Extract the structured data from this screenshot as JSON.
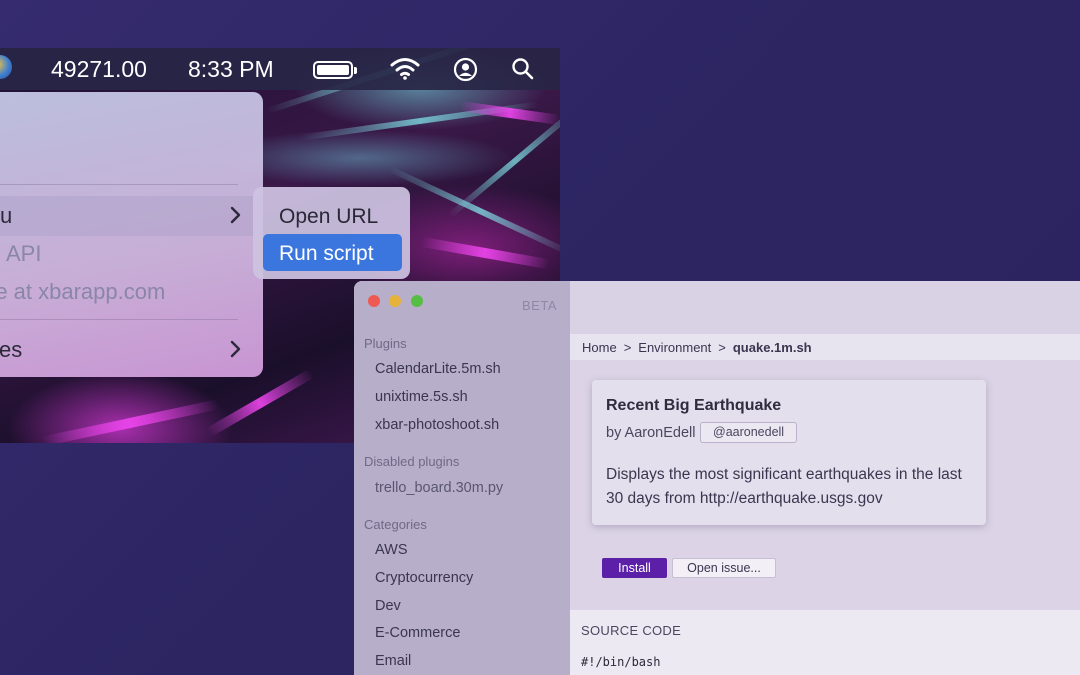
{
  "menubar": {
    "counter": "49271.00",
    "time": "8:33 PM",
    "icons": [
      "globe-icon",
      "battery-icon",
      "wifi-icon",
      "user-circle-icon",
      "search-icon"
    ]
  },
  "menu": {
    "items": [
      {
        "label": "u",
        "has_submenu": true,
        "highlighted": true
      },
      {
        "label": "API",
        "dimmed": true
      },
      {
        "label": "re at xbarapp.com",
        "dimmed": true
      },
      {
        "label": "ces",
        "has_submenu": true
      }
    ]
  },
  "submenu": {
    "items": [
      {
        "label": "Open URL"
      },
      {
        "label": "Run script",
        "active": true
      }
    ]
  },
  "app": {
    "beta_label": "BETA",
    "sidebar": {
      "plugins_heading": "Plugins",
      "plugins": [
        "CalendarLite.5m.sh",
        "unixtime.5s.sh",
        "xbar-photoshoot.sh"
      ],
      "disabled_heading": "Disabled plugins",
      "disabled": [
        "trello_board.30m.py"
      ],
      "categories_heading": "Categories",
      "categories": [
        "AWS",
        "Cryptocurrency",
        "Dev",
        "E-Commerce",
        "Email"
      ]
    },
    "breadcrumb": {
      "home": "Home",
      "sep": ">",
      "section": "Environment",
      "current": "quake.1m.sh"
    },
    "plugin": {
      "title": "Recent Big Earthquake",
      "by": "by AaronEdell",
      "handle": "@aaronedell",
      "description": "Displays the most significant earthquakes in the last 30 days from http://earthquake.usgs.gov"
    },
    "buttons": {
      "install": "Install",
      "open_issue": "Open issue..."
    },
    "source": {
      "heading": "SOURCE CODE",
      "code": "#!/bin/bash"
    },
    "colors": {
      "install_bg": "#5b1fa8",
      "run_script_highlight": "#3b76df",
      "traffic_red": "#ee5a52",
      "traffic_yellow": "#e6b23a",
      "traffic_green": "#57be45"
    }
  }
}
